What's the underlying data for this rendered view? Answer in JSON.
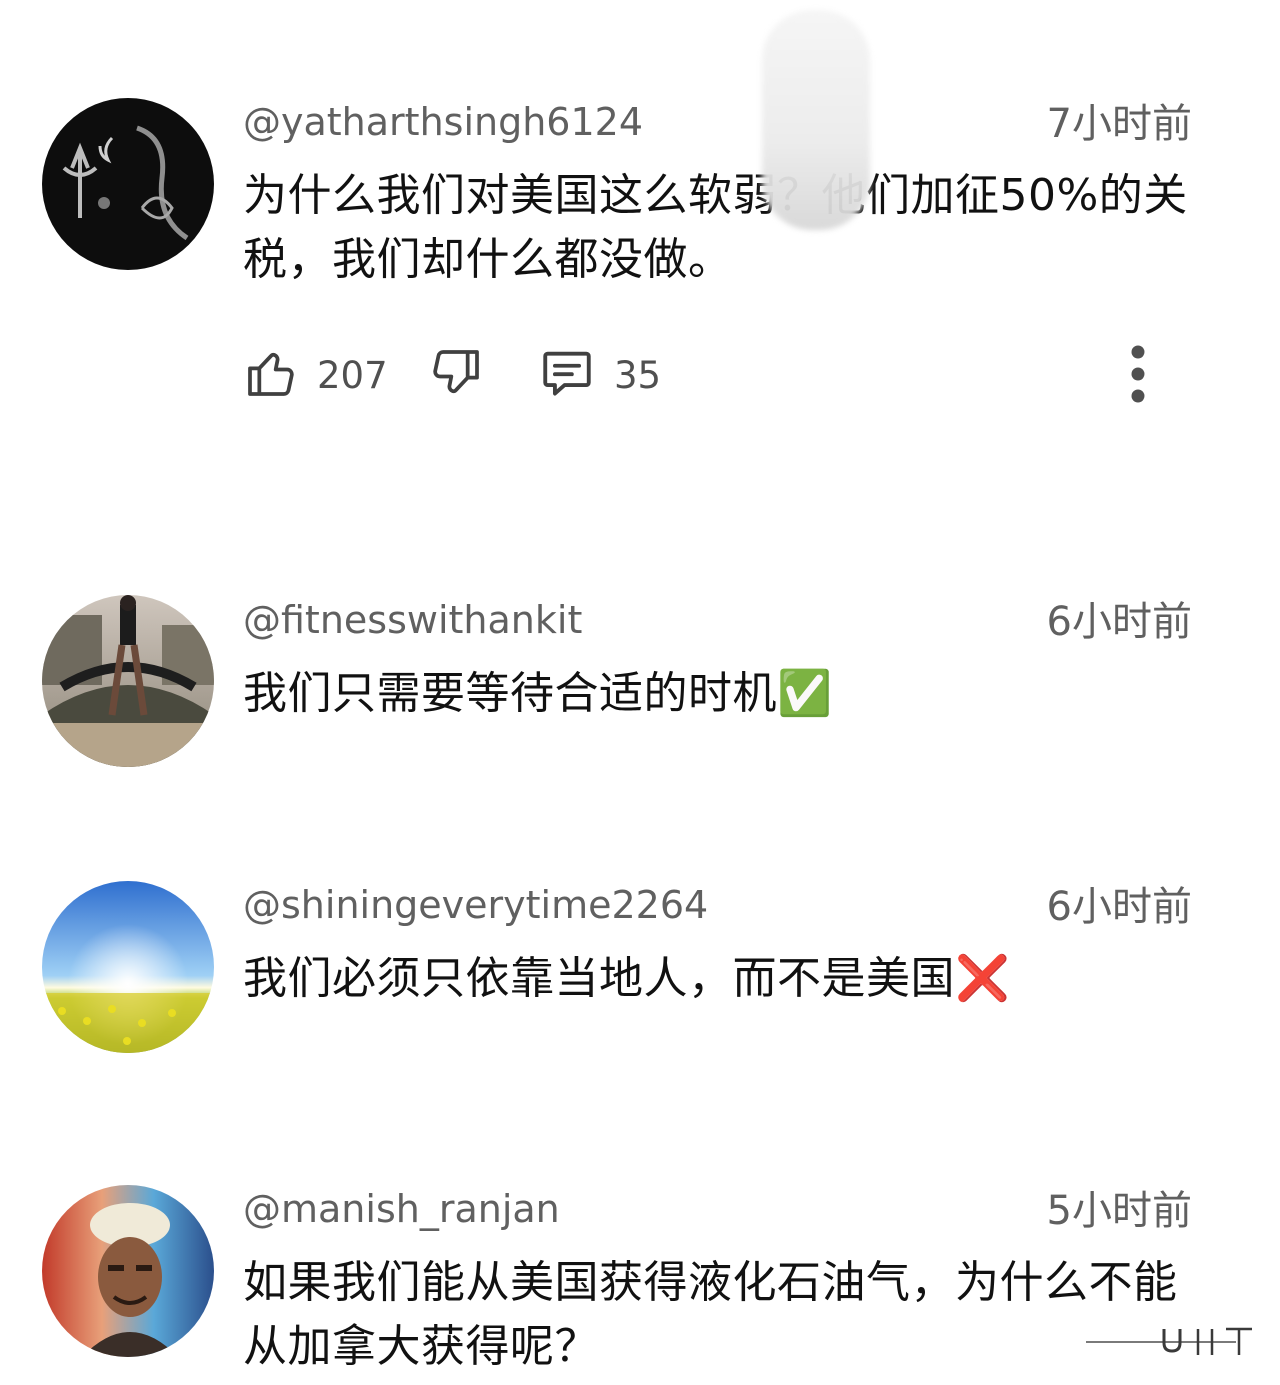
{
  "comments": [
    {
      "username": "@yatharthsingh6124",
      "time": "7小时前",
      "text": "为什么我们对美国这么软弱？他们加征50%的关税，我们却什么都没做。",
      "likes": "207",
      "replies": "35"
    },
    {
      "username": "@fitnesswithankit",
      "time": "6小时前",
      "text": "我们只需要等待合适的时机✅"
    },
    {
      "username": "@shiningeverytime2264",
      "time": "6小时前",
      "text": "我们必须只依靠当地人，而不是美国❌"
    },
    {
      "username": "@manish_ranjan",
      "time": "5小时前",
      "text": "如果我们能从美国获得液化石油气，为什么不能从加拿大获得呢？"
    }
  ],
  "icons": {
    "like": "thumbs-up-icon",
    "dislike": "thumbs-down-icon",
    "reply": "comment-icon",
    "more": "more-vertical-icon"
  },
  "colors": {
    "meta_text": "#606060",
    "body_text": "#111111",
    "icon": "#404040"
  }
}
